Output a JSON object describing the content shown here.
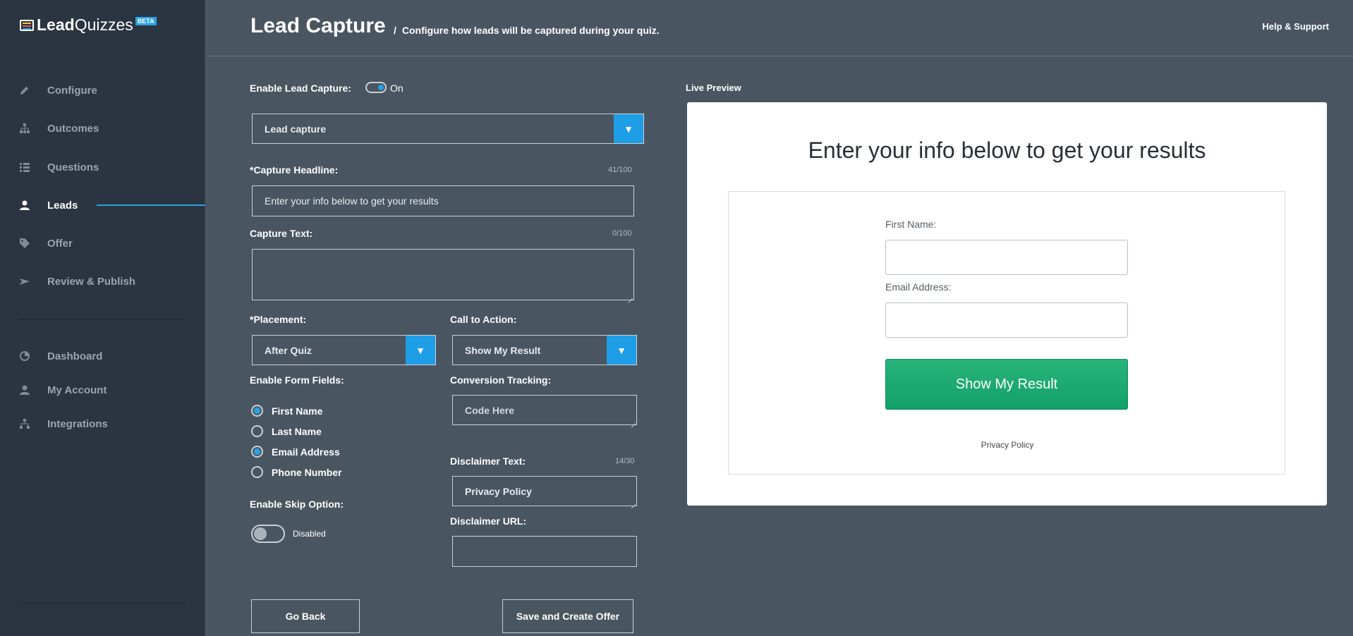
{
  "app": {
    "logo_lead": "Lead",
    "logo_quizzes": "Quizzes",
    "logo_badge": "BETA",
    "accent": "#29a3e6",
    "sidebar_bg": "#2b3541",
    "content_bg": "#4a5562"
  },
  "sidebar": {
    "items": [
      {
        "label": "Configure",
        "icon": "pencil-icon"
      },
      {
        "label": "Outcomes",
        "icon": "sitemap-icon"
      },
      {
        "label": "Questions",
        "icon": "list-icon"
      },
      {
        "label": "Leads",
        "icon": "user-icon",
        "active": true
      },
      {
        "label": "Offer",
        "icon": "tag-icon"
      },
      {
        "label": "Review & Publish",
        "icon": "send-icon"
      }
    ],
    "secondary": [
      {
        "label": "Dashboard",
        "icon": "pie-chart-icon"
      },
      {
        "label": "My Account",
        "icon": "person-icon"
      },
      {
        "label": "Integrations",
        "icon": "network-icon"
      }
    ]
  },
  "header": {
    "title": "Lead Capture",
    "separator": "/",
    "subtitle": "Configure how leads will be captured during your quiz.",
    "help": "Help & Support"
  },
  "form": {
    "enable_lead_capture_label": "Enable Lead Capture:",
    "enable_lead_capture_state": "On",
    "type_select_value": "Lead capture",
    "capture_headline_label": "*Capture Headline:",
    "capture_headline_counter": "41/100",
    "capture_headline_value": "Enter your info below to get your results",
    "capture_text_label": "Capture Text:",
    "capture_text_counter": "0/100",
    "capture_text_value": "",
    "placement_label": "*Placement:",
    "placement_value": "After Quiz",
    "cta_label": "Call to Action:",
    "cta_value": "Show My Result",
    "form_fields_label": "Enable Form Fields:",
    "form_fields": [
      {
        "label": "First Name",
        "checked": true
      },
      {
        "label": "Last Name",
        "checked": false
      },
      {
        "label": "Email Address",
        "checked": true
      },
      {
        "label": "Phone Number",
        "checked": false
      }
    ],
    "conversion_label": "Conversion Tracking:",
    "conversion_placeholder": "Code Here",
    "disclaimer_text_label": "Disclaimer Text:",
    "disclaimer_text_counter": "14/30",
    "disclaimer_text_value": "Privacy Policy",
    "disclaimer_url_label": "Disclaimer URL:",
    "disclaimer_url_value": "",
    "skip_label": "Enable Skip Option:",
    "skip_state": "Disabled",
    "go_back": "Go Back",
    "save_offer": "Save and Create Offer"
  },
  "preview": {
    "label": "Live Preview",
    "headline": "Enter your info below to get your results",
    "first_name_label": "First Name:",
    "email_label": "Email Address:",
    "button": "Show My Result",
    "button_color": "#1aa870",
    "privacy": "Privacy Policy"
  }
}
